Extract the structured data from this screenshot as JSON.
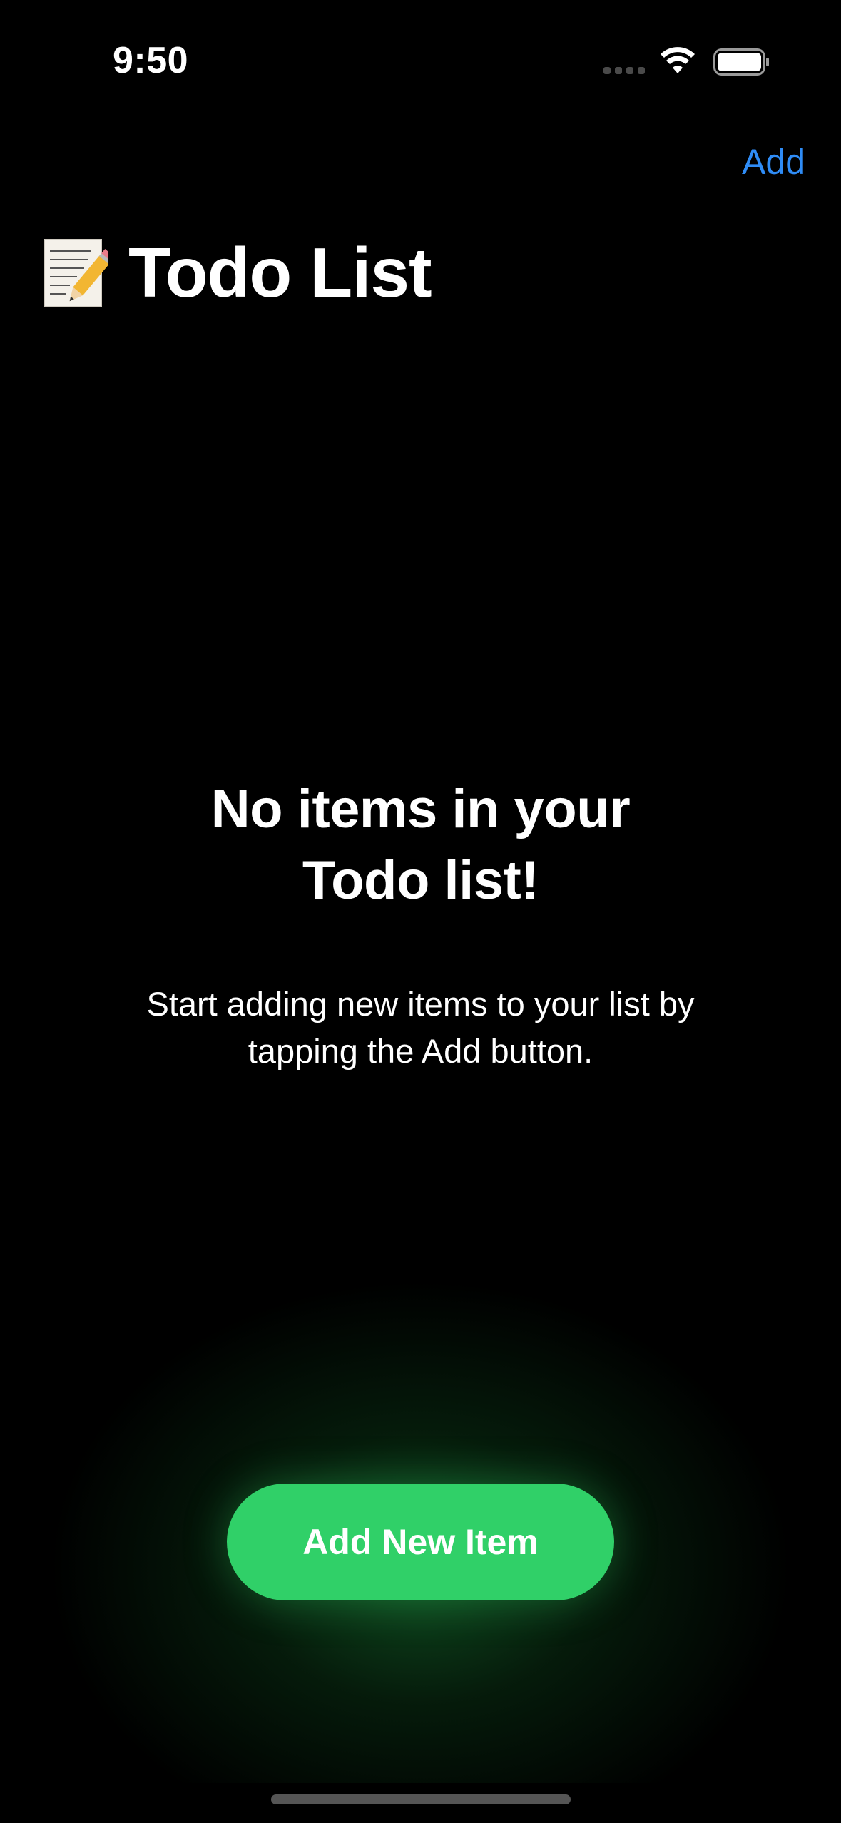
{
  "status_bar": {
    "time": "9:50",
    "icons": [
      "cellular-signal-icon",
      "wifi-icon",
      "battery-icon"
    ]
  },
  "nav": {
    "add_label": "Add",
    "title_icon": "memo-icon",
    "title": "Todo List"
  },
  "empty_state": {
    "heading_line1": "No items in your",
    "heading_line2": "Todo list!",
    "message_line1": "Start adding new items to your list by",
    "message_line2": "tapping the Add button."
  },
  "actions": {
    "add_new_item_label": "Add New Item"
  },
  "colors": {
    "background": "#000000",
    "accent_link": "#2f8cf6",
    "button_green": "#30d068",
    "text": "#ffffff"
  }
}
